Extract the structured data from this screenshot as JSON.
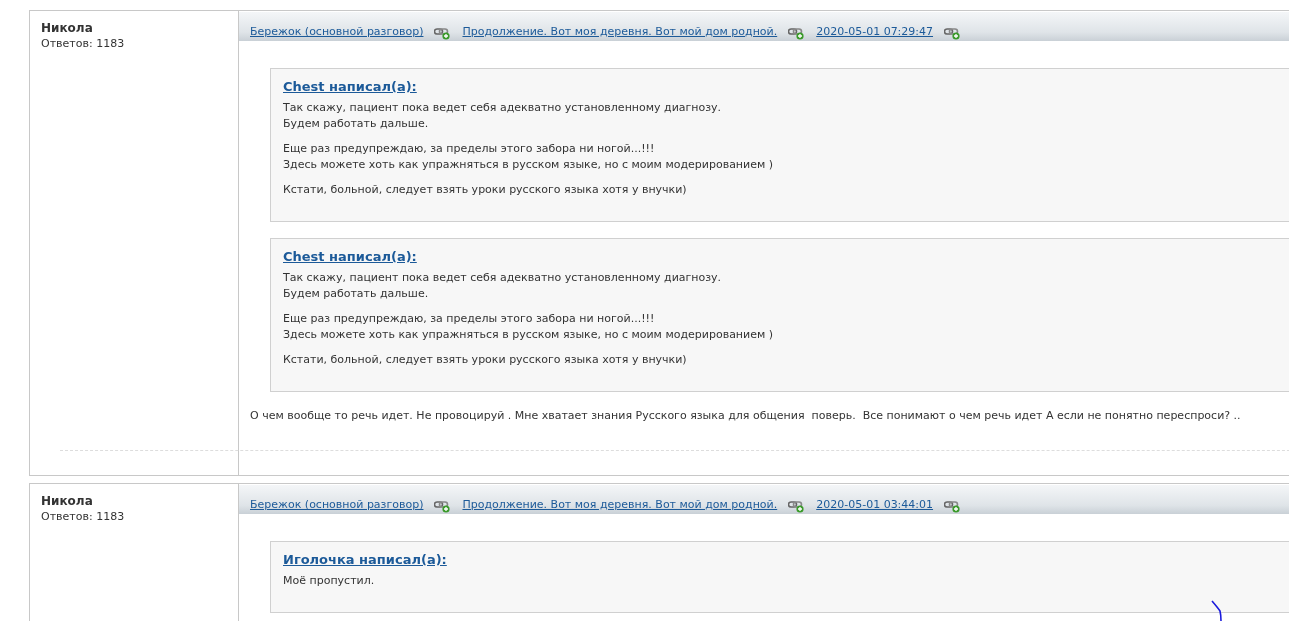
{
  "posts": [
    {
      "author": "Никола",
      "replies": "Ответов: 1183",
      "links": [
        "Бережок (основной разговор)",
        "Продолжение. Вот моя деревня. Вот мой дом родной.",
        "2020-05-01 07:29:47"
      ],
      "quotes": [
        {
          "title": "Chest написал(а):",
          "paragraphs": [
            [
              "Так скажу, пациент пока ведет себя адекватно установленному диагнозу.",
              "Будем работать дальше."
            ],
            [
              "Еще раз предупреждаю, за пределы этого забора ни ногой...!!!",
              "Здесь можете хоть как упражняться в русском языке, но с моим модерированием )"
            ],
            [
              "Кстати, больной, следует взять уроки русского языка хотя у внучки)"
            ]
          ]
        },
        {
          "title": "Chest написал(а):",
          "paragraphs": [
            [
              "Так скажу, пациент пока ведет себя адекватно установленному диагнозу.",
              "Будем работать дальше."
            ],
            [
              "Еще раз предупреждаю, за пределы этого забора ни ногой...!!!",
              "Здесь можете хоть как упражняться в русском языке, но с моим модерированием )"
            ],
            [
              "Кстати, больной, следует взять уроки русского языка хотя у внучки)"
            ]
          ]
        }
      ],
      "body": "О чем вообще то речь идет. Не провоцируй . Мне хватает знания Русского языка для общения  поверь.  Все понимают о чем речь идет А если не понятно переспроси? .."
    },
    {
      "author": "Никола",
      "replies": "Ответов: 1183",
      "links": [
        "Бережок (основной разговор)",
        "Продолжение. Вот моя деревня. Вот мой дом родной.",
        "2020-05-01 03:44:01"
      ],
      "quotes": [
        {
          "title": "Иголочка написал(а):",
          "paragraphs": [
            [
              "Моё пропустил."
            ]
          ]
        }
      ]
    }
  ]
}
